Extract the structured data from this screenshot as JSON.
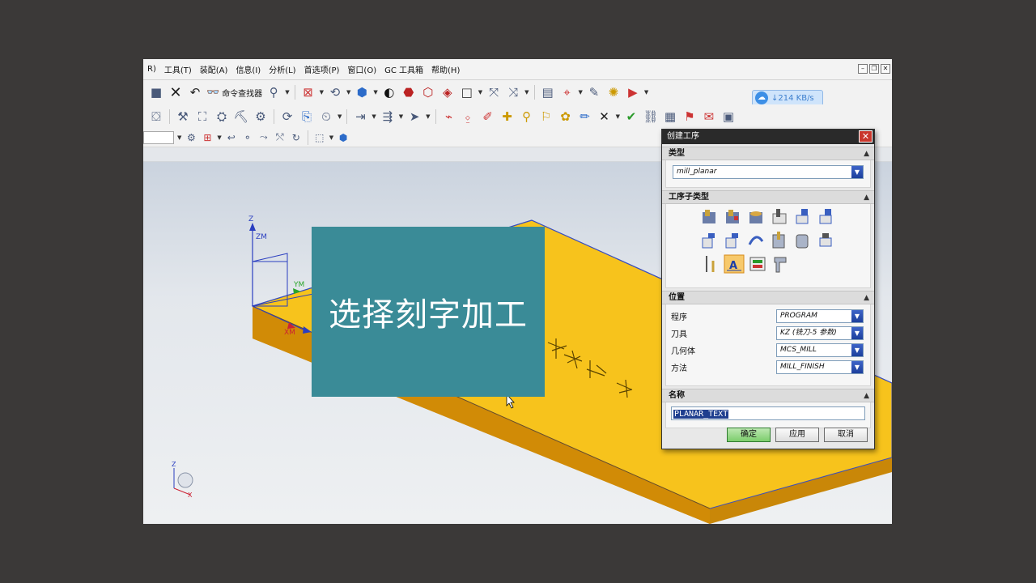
{
  "menu": {
    "items": [
      "R)",
      "工具(T)",
      "装配(A)",
      "信息(I)",
      "分析(L)",
      "首选项(P)",
      "窗口(O)",
      "GC 工具箱",
      "帮助(H)"
    ]
  },
  "toolbar": {
    "command_finder_label": "命令查找器"
  },
  "net_speed": {
    "text": "↓214 KB/s"
  },
  "caption": {
    "text": "选择刻字加工"
  },
  "axes": {
    "z": "Z",
    "zm": "ZM",
    "ym": "YM",
    "xm": "XM",
    "triad_z": "Z",
    "triad_x": "X"
  },
  "dialog": {
    "title": "创建工序",
    "type_section": "类型",
    "type_value": "mill_planar",
    "subtype_section": "工序子类型",
    "location_section": "位置",
    "location_rows": [
      {
        "label": "程序",
        "value": "PROGRAM"
      },
      {
        "label": "刀具",
        "value": "KZ (铣刀-5 参数)"
      },
      {
        "label": "几何体",
        "value": "MCS_MILL"
      },
      {
        "label": "方法",
        "value": "MILL_FINISH"
      }
    ],
    "name_section": "名称",
    "name_value": "PLANAR_TEXT",
    "buttons": {
      "ok": "确定",
      "apply": "应用",
      "cancel": "取消"
    }
  },
  "colors": {
    "background": "#3b3938",
    "part_top": "#f7c31c",
    "part_side": "#c98708",
    "caption_bg": "#3a8b97",
    "dialog_title": "#2a2a2a",
    "selection": "#1f3f8f"
  }
}
